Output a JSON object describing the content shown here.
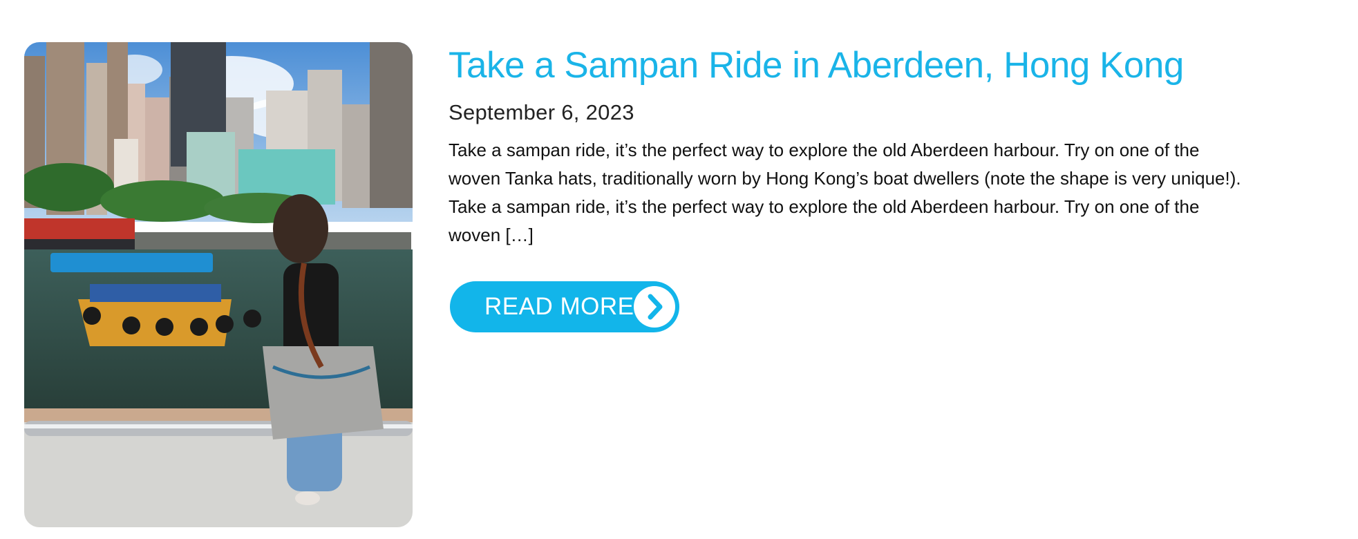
{
  "post": {
    "title": "Take a Sampan Ride in Aberdeen, Hong Kong",
    "date": "September 6, 2023",
    "excerpt": "Take a sampan ride, it’s the perfect way to explore the old Aberdeen harbour.  Try on one of the woven Tanka hats, traditionally worn by Hong Kong’s boat dwellers (note the shape is very unique!). Take a sampan ride, it’s the perfect way to explore the old Aberdeen harbour.  Try on one of the woven […]",
    "read_more_label": "READ MORE",
    "read_more_icon": "chevron-right-circle-icon",
    "featured_image": "photo of a woman with a tote bag at Aberdeen harbour rail looking at a sampan boat, high-rise buildings behind"
  },
  "colors": {
    "accent": "#1ab4e8",
    "button": "#12b5ea",
    "text": "#111111"
  }
}
